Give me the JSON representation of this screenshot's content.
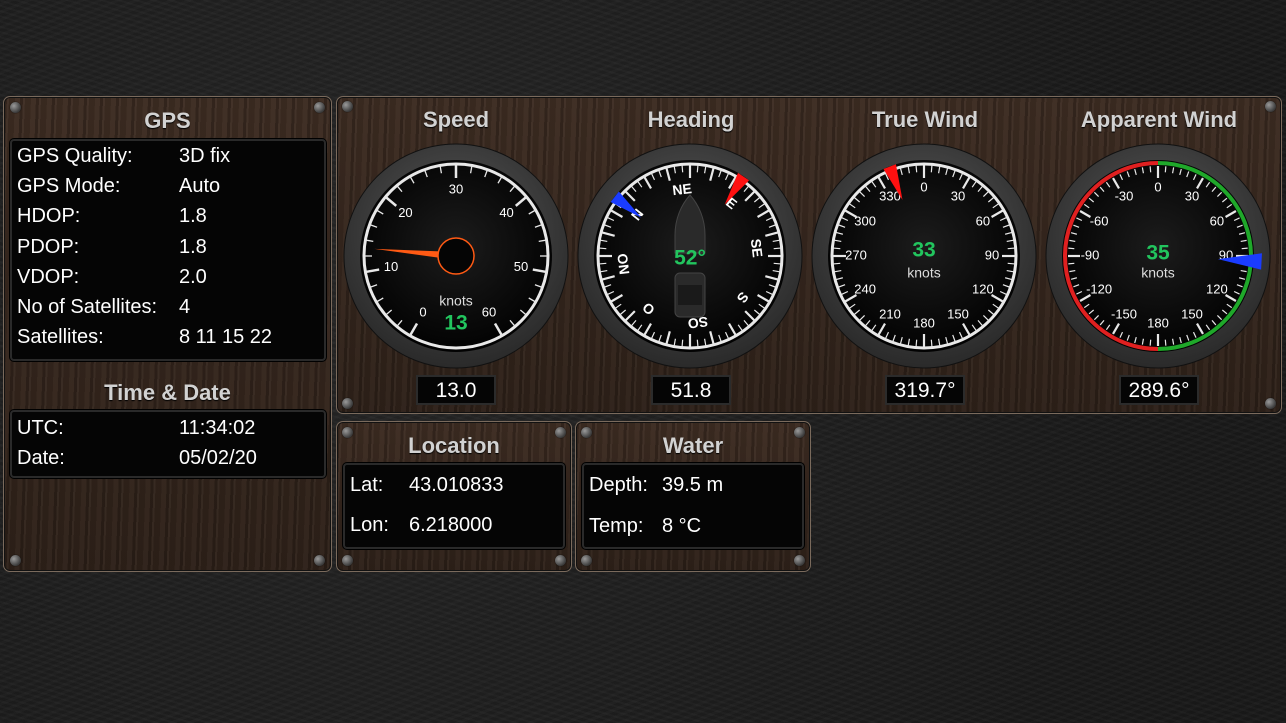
{
  "gps": {
    "title": "GPS",
    "rows": [
      {
        "label": "GPS Quality:",
        "value": "3D fix"
      },
      {
        "label": "GPS Mode:",
        "value": "Auto"
      },
      {
        "label": "HDOP:",
        "value": "1.8"
      },
      {
        "label": "PDOP:",
        "value": "1.8"
      },
      {
        "label": "VDOP:",
        "value": "2.0"
      },
      {
        "label": "No of Satellites:",
        "value": "4"
      },
      {
        "label": "Satellites:",
        "value": "8 11 15 22"
      }
    ]
  },
  "time": {
    "title": "Time & Date",
    "rows": [
      {
        "label": "UTC:",
        "value": "11:34:02"
      },
      {
        "label": "Date:",
        "value": "05/02/20"
      }
    ]
  },
  "gauges": {
    "speed": {
      "title": "Speed",
      "unit": "knots",
      "center_value": "13",
      "readout": "13.0",
      "needle": 13,
      "ticks": [
        "0",
        "10",
        "20",
        "30",
        "40",
        "50",
        "60"
      ]
    },
    "heading": {
      "title": "Heading",
      "center_value": "52°",
      "readout": "51.8",
      "needle": 51.8,
      "labels": [
        "N",
        "NE",
        "E",
        "SE",
        "S",
        "SO",
        "O",
        "NO"
      ]
    },
    "true_wind": {
      "title": "True Wind",
      "unit": "knots",
      "center_value": "33",
      "readout": "319.7°",
      "needle": 339,
      "ticks": [
        "0",
        "30",
        "60",
        "90",
        "120",
        "150",
        "180",
        "210",
        "240",
        "270",
        "300",
        "330"
      ]
    },
    "apparent_wind": {
      "title": "Apparent Wind",
      "unit": "knots",
      "center_value": "35",
      "readout": "289.6°",
      "needle": 93,
      "ticks": [
        "0",
        "30",
        "60",
        "90",
        "120",
        "150",
        "180",
        "-150",
        "-120",
        "-90",
        "-60",
        "-30"
      ]
    }
  },
  "location": {
    "title": "Location",
    "lat_label": "Lat:",
    "lat_value": "43.010833",
    "lon_label": "Lon:",
    "lon_value": "6.218000"
  },
  "water": {
    "title": "Water",
    "depth_label": "Depth:",
    "depth_value": "39.5 m",
    "temp_label": "Temp:",
    "temp_value": "8 °C"
  },
  "colors": {
    "needle_orange": "#ff5a14",
    "needle_red": "#ff1010",
    "needle_blue": "#1a3cff",
    "value_green": "#22c55e",
    "port_red": "#e02020",
    "starboard_green": "#1fa82a"
  }
}
